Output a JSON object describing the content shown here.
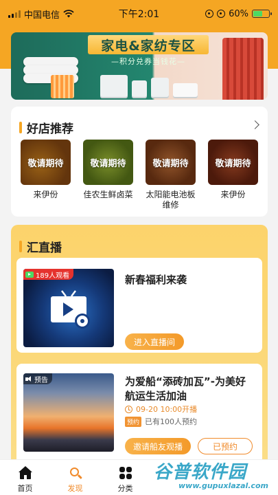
{
  "status_bar": {
    "carrier": "中国电信",
    "time": "下午2:01",
    "battery": "60%",
    "battery_level": 0.6,
    "icons": [
      "signal-icon",
      "wifi-icon",
      "location-icon",
      "alarm-icon",
      "battery-icon"
    ]
  },
  "banner": {
    "title": "家电&家纺专区",
    "subtitle": "—积分兑券当钱花—"
  },
  "shops": {
    "title": "好店推荐",
    "items": [
      {
        "overlay": "敬请期待",
        "name": "来伊份"
      },
      {
        "overlay": "敬请期待",
        "name": "佳农生鲜卤菜"
      },
      {
        "overlay": "敬请期待",
        "name": "太阳能电池板维修"
      },
      {
        "overlay": "敬请期待",
        "name": "来伊份"
      }
    ]
  },
  "live": {
    "title": "汇直播",
    "items": [
      {
        "badge": "189人观看",
        "title": "新春福利来袭",
        "button": "进入直播间"
      },
      {
        "badge": "预告",
        "title": "为爱船“添砖加瓦”-为美好航运生活加油",
        "time": "09-20 10:00开播",
        "tag": "预约",
        "reserved_count": "已有100人预约",
        "button_invite": "邀请船友观播",
        "button_reserved": "已预约"
      }
    ]
  },
  "tabbar": {
    "tabs": [
      {
        "label": "首页"
      },
      {
        "label": "发现"
      },
      {
        "label": "分类"
      }
    ],
    "active": "发现"
  },
  "watermark": {
    "main": "谷普软件园",
    "sub": "www.gupuxlazal.com"
  },
  "colors": {
    "accent": "#f5a623",
    "live_badge": "#e5322d",
    "active_tab": "#f08a2a"
  }
}
